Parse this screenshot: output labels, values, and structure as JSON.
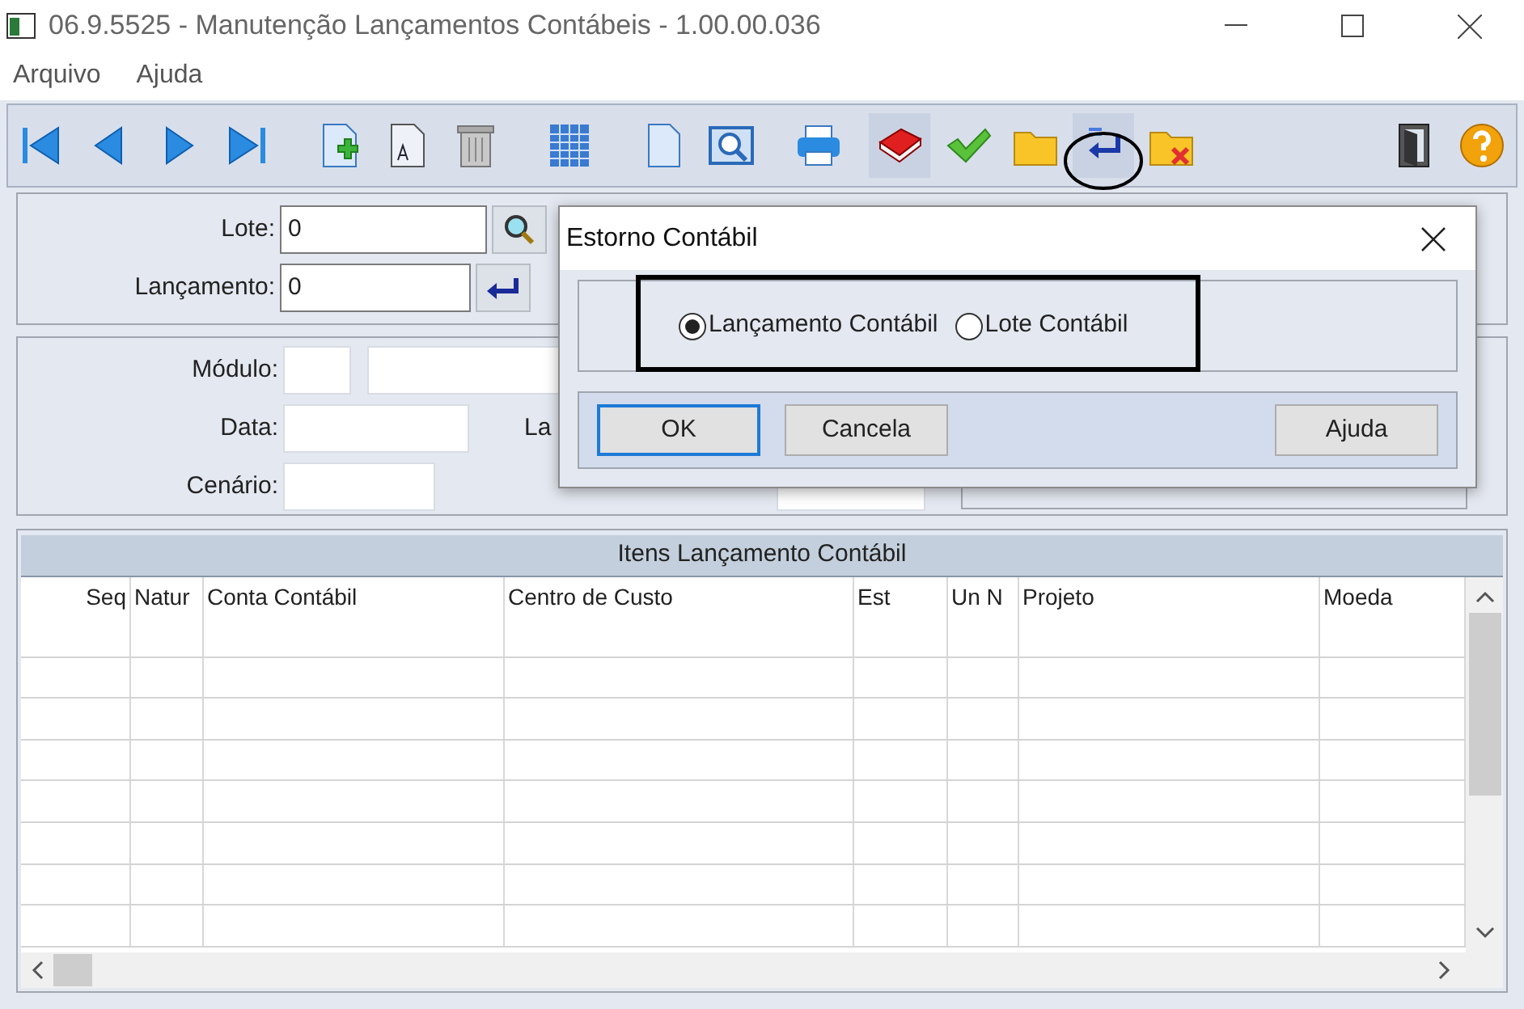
{
  "window": {
    "title": "06.9.5525 - Manutenção Lançamentos Contábeis - 1.00.00.036"
  },
  "menu": [
    "Arquivo",
    "Ajuda"
  ],
  "header_fields": [
    {
      "label": "Lote:",
      "value": "0"
    },
    {
      "label": "Lançamento:",
      "value": "0"
    }
  ],
  "detail_labels": {
    "module": "Módulo:",
    "date": "Data:",
    "scenario": "Cenário:",
    "cut_label": "La"
  },
  "grid": {
    "title": "Itens Lançamento Contábil",
    "columns": [
      "Seq",
      "Natur",
      "Conta Contábil",
      "Centro de Custo",
      "Est",
      "Un N",
      "Projeto",
      "Moeda"
    ]
  },
  "dialog": {
    "title": "Estorno Contábil",
    "options": [
      {
        "label": "Lançamento Contábil",
        "selected": true
      },
      {
        "label": "Lote Contábil",
        "selected": false
      }
    ],
    "buttons": [
      {
        "label": "OK",
        "focused": true
      },
      {
        "label": "Cancela",
        "focused": false
      },
      {
        "label": "Ajuda",
        "focused": false
      }
    ]
  }
}
